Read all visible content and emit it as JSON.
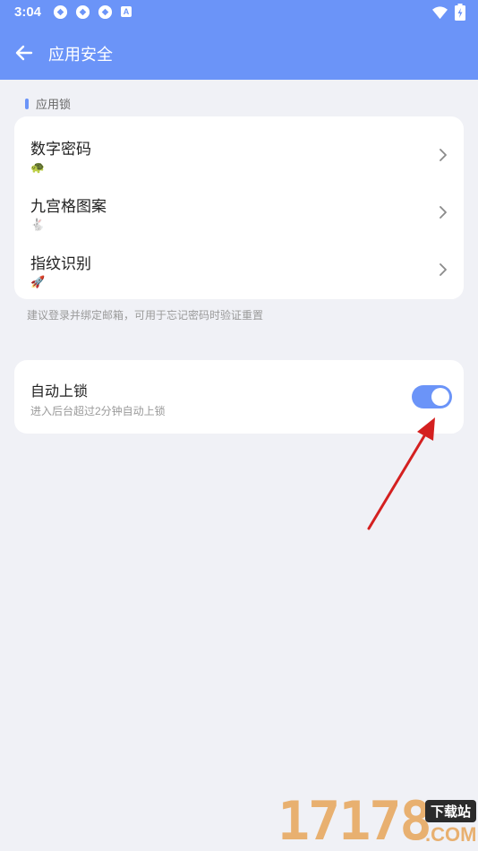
{
  "status_bar": {
    "time": "3:04",
    "notification_icons": [
      "sync-icon",
      "sync-icon",
      "sync-icon",
      "text-badge-icon"
    ],
    "badge_letter": "A",
    "right_icons": [
      "wifi-icon",
      "battery-charging-icon"
    ]
  },
  "header": {
    "title": "应用安全",
    "back_icon": "arrow-left-icon"
  },
  "app_lock": {
    "section_label": "应用锁",
    "items": [
      {
        "label": "数字密码",
        "sub_icon": "🐢"
      },
      {
        "label": "九宫格图案",
        "sub_icon": "🐇"
      },
      {
        "label": "指纹识别",
        "sub_icon": "🚀"
      }
    ],
    "hint": "建议登录并绑定邮箱，可用于忘记密码时验证重置"
  },
  "auto_lock": {
    "label": "自动上锁",
    "description": "进入后台超过2分钟自动上锁",
    "enabled": true
  },
  "watermark": {
    "number": "17178",
    "tag": "下载站",
    "domain": ".COM"
  },
  "colors": {
    "accent": "#6b94f8",
    "background": "#f0f1f6",
    "annotation_arrow": "#d42020"
  }
}
